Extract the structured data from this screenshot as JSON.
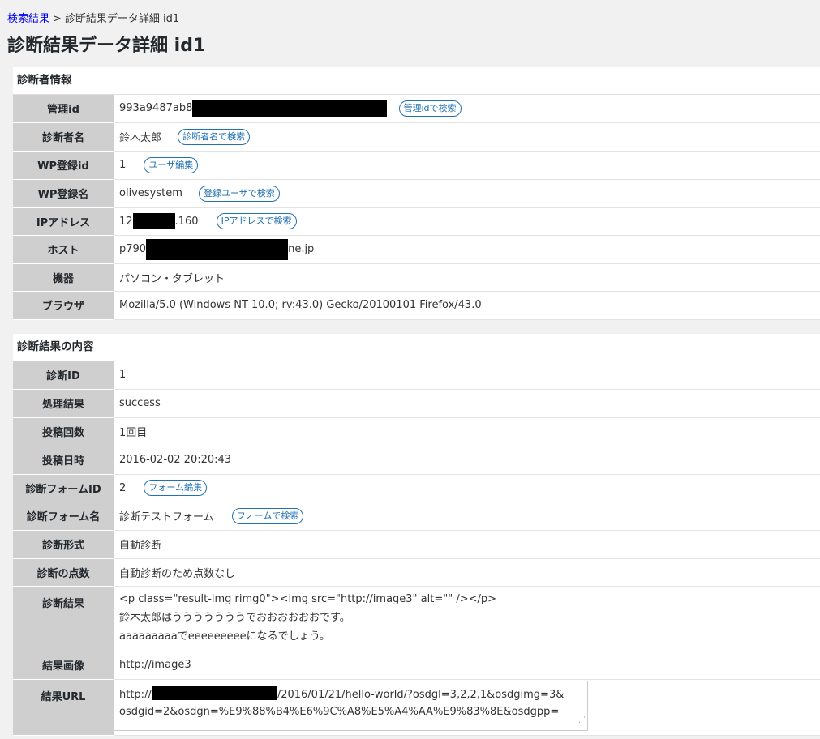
{
  "breadcrumb": {
    "link": "検索結果",
    "separator": ">",
    "current": "診断結果データ詳細 id1"
  },
  "page_title": "診断結果データ詳細 id1",
  "diagnoser": {
    "title": "診断者情報",
    "admin_id": {
      "label": "管理id",
      "value": "993a9487ab8",
      "button": "管理idで検索"
    },
    "name": {
      "label": "診断者名",
      "value": "鈴木太郎",
      "button": "診断者名で検索"
    },
    "wp_id": {
      "label": "WP登録id",
      "value": "1",
      "button": "ユーザ編集"
    },
    "wp_name": {
      "label": "WP登録名",
      "value": "olivesystem",
      "button": "登録ユーザで検索"
    },
    "ip": {
      "label": "IPアドレス",
      "value_prefix": "12",
      "value_suffix": ".160",
      "button": "IPアドレスで検索"
    },
    "host": {
      "label": "ホスト",
      "value_prefix": "p790",
      "value_suffix": "ne.jp"
    },
    "device": {
      "label": "機器",
      "value": "パソコン・タブレット"
    },
    "browser": {
      "label": "ブラウザ",
      "value": "Mozilla/5.0 (Windows NT 10.0; rv:43.0) Gecko/20100101 Firefox/43.0"
    }
  },
  "result": {
    "title": "診断結果の内容",
    "diag_id": {
      "label": "診断ID",
      "value": "1"
    },
    "process": {
      "label": "処理結果",
      "value": "success"
    },
    "post_count": {
      "label": "投稿回数",
      "value": "1回目"
    },
    "post_date": {
      "label": "投稿日時",
      "value": "2016-02-02 20:20:43"
    },
    "form_id": {
      "label": "診断フォームID",
      "value": "2",
      "button": "フォーム編集"
    },
    "form_name": {
      "label": "診断フォーム名",
      "value": "診断テストフォーム",
      "button": "フォームで検索"
    },
    "format": {
      "label": "診断形式",
      "value": "自動診断"
    },
    "score": {
      "label": "診断の点数",
      "value": "自動診断のため点数なし"
    },
    "result_text": {
      "label": "診断結果",
      "lines": [
        "<p class=\"result-img rimg0\"><img src=\"http://image3\" alt=\"\" /></p>",
        "鈴木太郎はうううううううでおおおおおおです。",
        "aaaaaaaaaでeeeeeeeeeになるでしょう。"
      ]
    },
    "image": {
      "label": "結果画像",
      "value": "http://image3"
    },
    "url": {
      "label": "結果URL",
      "prefix": "http://",
      "line1_rest": "/2016/01/21/hello-world/?osdgl=3,2,2,1&osdgimg=3&",
      "line2": "osdgid=2&osdgn=%E9%88%B4%E6%9C%A8%E5%A4%AA%E9%83%8E&osdgpp="
    }
  },
  "icons": {
    "resize_grip": "resize-grip-icon"
  },
  "colors": {
    "header_bg": "#cfcfcf",
    "button_border": "#2271b1",
    "link": "#0000ee"
  }
}
